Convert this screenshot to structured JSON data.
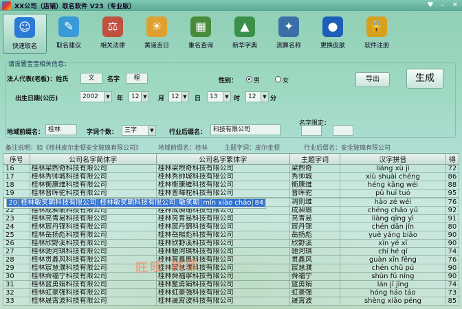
{
  "window": {
    "title": "XX公司（店铺）取名软件 V23（专业版）"
  },
  "toolbar": [
    {
      "label": "快速取名",
      "icon": "quick-name-icon",
      "color": "#2b7ad6"
    },
    {
      "label": "取名建议",
      "icon": "suggestion-icon",
      "color": "#3a9ad8"
    },
    {
      "label": "相关法律",
      "icon": "law-icon",
      "color": "#c05040"
    },
    {
      "label": "黄道吉日",
      "icon": "lucky-day-icon",
      "color": "#e0a030"
    },
    {
      "label": "重名查询",
      "icon": "duplicate-query-icon",
      "color": "#4a8a3c"
    },
    {
      "label": "新华字典",
      "icon": "dictionary-icon",
      "color": "#3a8f4a"
    },
    {
      "label": "测算名称",
      "icon": "calculate-icon",
      "color": "#3b6fa8"
    },
    {
      "label": "更换皮肤",
      "icon": "change-skin-icon",
      "color": "#1d5fb8"
    },
    {
      "label": "软件注册",
      "icon": "register-icon",
      "color": "#d8a020"
    }
  ],
  "form": {
    "section_title": "请设置宝宝相关信息：",
    "legal_rep_label": "法人代表(老板)：姓氏",
    "surname": "文",
    "name_label": "名字",
    "given_name": "程",
    "gender_label": "性别：",
    "male": "男",
    "female": "女",
    "birth_label": "出生日期(公历)",
    "year": "2002",
    "year_unit": "年",
    "month": "12",
    "month_unit": "月",
    "day": "12",
    "day_unit": "日",
    "hour": "13",
    "hour_unit": "时",
    "minute": "12",
    "minute_unit": "分",
    "prefix_label": "地域前缀名：",
    "prefix": "桂林",
    "char_count_label": "字词个数：",
    "char_count": "三字",
    "suffix_label": "行业后缀名：",
    "suffix": "科技有限公司",
    "name_limit_label": "名字限定：",
    "export": "导出",
    "generate": "生成"
  },
  "hint": {
    "remark": "备注说明：如《桂林皮尔金顿安全玻璃有限公司》",
    "region": "地域前缀名：桂林",
    "subject": "主题字词：皮尔金顿",
    "industry": "行业后缀名：安全玻璃有限公司"
  },
  "table": {
    "columns": [
      "序号",
      "公司名字简体字",
      "公司名字繁体字",
      "主题字词",
      "汉字拼音",
      "得"
    ],
    "rows": [
      [
        "16",
        "桂林梁煦奇科技有限公司",
        "桂林梁煦奇科技有限公司",
        "梁煦奇",
        "liáng xù jì",
        "72"
      ],
      [
        "17",
        "桂林秀帅城科技有限公司",
        "桂林秀帥城科技有限公司",
        "秀帅城",
        "xiù shuài chéng",
        "86"
      ],
      [
        "18",
        "桂林衡康维科技有限公司",
        "桂林衡康維科技有限公司",
        "衡康维",
        "héng kāng wéi",
        "88"
      ],
      [
        "19",
        "桂林普晖驼科技有限公司",
        "桂林普暉駝科技有限公司",
        "普晖驼",
        "pǔ huī tuó",
        "95"
      ],
      [
        "20",
        "桂林敏笑朝科技有限公司",
        "桂林敏笑朝科技有限公司",
        "敏笑朝",
        "mǐn xiào cháo",
        "84"
      ],
      [
        "21",
        "桂林凋则维科技有限公司",
        "桂林凋則維科技有限公司",
        "凋则维",
        "hào zé wéi",
        "76"
      ],
      [
        "22",
        "桂林成昶瑜科技有限公司",
        "桂林成昶瑜科技有限公司",
        "成昶瑜",
        "chéng chǎo yú",
        "92"
      ],
      [
        "23",
        "桂林亮青易科技有限公司",
        "桂林亮青易科技有限公司",
        "亮青易",
        "liàng qīng yì",
        "91"
      ],
      [
        "24",
        "桂林宸丹锦科技有限公司",
        "桂林宸丹錦科技有限公司",
        "宸丹锦",
        "chén dān jǐn",
        "80"
      ],
      [
        "25",
        "桂林岳扬彪科技有限公司",
        "桂林岳揚彪科技有限公司",
        "岳扬彪",
        "yuè yáng biāo",
        "90"
      ],
      [
        "26",
        "桂林欣野溪科技有限公司",
        "桂林欣野溪科技有限公司",
        "欣野溪",
        "xīn yě xī",
        "90"
      ],
      [
        "27",
        "桂林驰河琪科技有限公司",
        "桂林馳河琪科技有限公司",
        "驰河琪",
        "chí hé qí",
        "74"
      ],
      [
        "28",
        "桂林贯鑫风科技有限公司",
        "桂林貫鑫風科技有限公司",
        "贯鑫风",
        "guàn xīn fēng",
        "76"
      ],
      [
        "29",
        "桂林宸慧濮科技有限公司",
        "桂林宸慧濮科技有限公司",
        "宸慧濮",
        "chén chū pú",
        "90"
      ],
      [
        "30",
        "桂林舜福宁科技有限公司",
        "桂林舜福寧科技有限公司",
        "舜福宁",
        "shùn fū níng",
        "90"
      ],
      [
        "31",
        "桂林蓝勇娟科技有限公司",
        "桂林藍勇娟科技有限公司",
        "蓝勇娟",
        "lán jī jīng",
        "74"
      ],
      [
        "32",
        "桂林虹豪强科技有限公司",
        "桂林虹豪強科技有限公司",
        "虹豪强",
        "hóng háo táo",
        "73"
      ],
      [
        "33",
        "桂林晟霄波科技有限公司",
        "桂林晟霄波科技有限公司",
        "晟霄波",
        "shèng xiāo péng",
        "85"
      ]
    ],
    "selected_index": 4
  },
  "watermark": "旺旺·林佳",
  "colors": {
    "selection": "#2f6fd0",
    "background": "#a9ddd0"
  }
}
